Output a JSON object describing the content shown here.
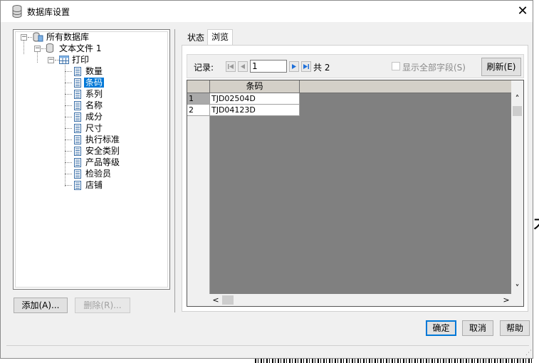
{
  "window": {
    "title": "数据库设置",
    "close_glyph": "✕"
  },
  "tree": {
    "root": "所有数据库",
    "db": "文本文件 1",
    "table": "打印",
    "fields": [
      "数量",
      "条码",
      "系列",
      "名称",
      "成分",
      "尺寸",
      "执行标准",
      "安全类别",
      "产品等级",
      "检验员",
      "店铺"
    ],
    "selected_index": 1
  },
  "left_buttons": {
    "add": "添加(A)...",
    "delete": "删除(R)..."
  },
  "tabs": [
    {
      "label": "状态"
    },
    {
      "label": "浏览"
    }
  ],
  "active_tab": 1,
  "nav": {
    "record_label": "记录:",
    "record_value": "1",
    "total_text": "共 2",
    "show_all_label": "显示全部字段(S)",
    "refresh_label": "刷新(E)"
  },
  "grid": {
    "column_header": "条码",
    "rows": [
      {
        "num": "1",
        "value": "TJD02504D"
      },
      {
        "num": "2",
        "value": "TJD04123D"
      }
    ],
    "up_glyph": "˄",
    "down_glyph": "˅",
    "left_glyph": "<",
    "right_glyph": ">"
  },
  "bottom_buttons": {
    "ok": "确定",
    "cancel": "取消",
    "help": "帮助"
  },
  "colors": {
    "selection": "#0078d7",
    "grid_bg": "#808080",
    "nav_blue": "#1e6fd9"
  }
}
